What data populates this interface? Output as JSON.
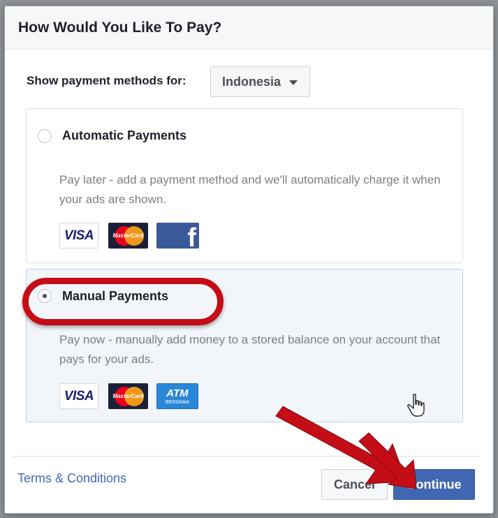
{
  "dialog": {
    "title": "How Would You Like To Pay?"
  },
  "country": {
    "label": "Show payment methods for:",
    "selected": "Indonesia"
  },
  "options": [
    {
      "title": "Automatic Payments",
      "description": "Pay later - add a payment method and we'll automatically charge it when your ads are shown.",
      "selected": false,
      "cards": [
        "visa-icon",
        "mastercard-icon",
        "facebook-icon"
      ]
    },
    {
      "title": "Manual Payments",
      "description": "Pay now - manually add money to a stored balance on your account that pays for your ads.",
      "selected": true,
      "cards": [
        "visa-icon",
        "mastercard-icon",
        "atm-bersama-icon"
      ]
    }
  ],
  "cards": {
    "visa": "VISA",
    "mastercard": "MasterCard",
    "facebook": "f",
    "atm": "ATM",
    "atm_sub": "BERSAMA"
  },
  "footer": {
    "terms_label": "Terms & Conditions",
    "cancel_label": "Cancel",
    "continue_label": "Continue"
  },
  "colors": {
    "accent": "#4267b2",
    "annotation_red": "#c40d17"
  }
}
